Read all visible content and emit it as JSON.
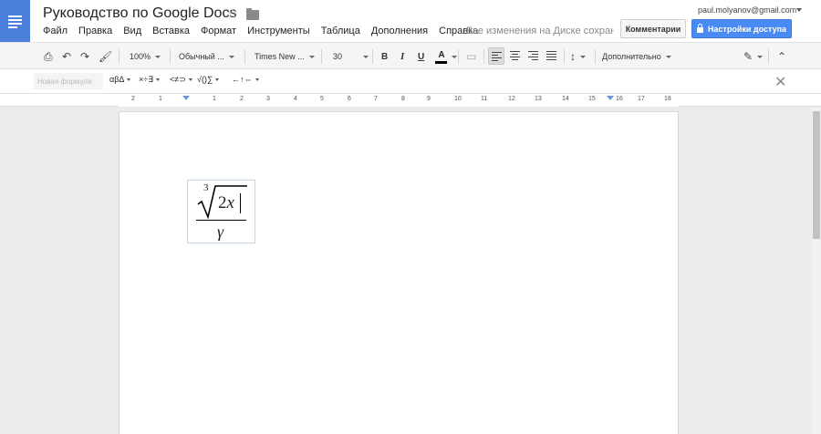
{
  "app": {
    "title": "Руководство по Google Docs",
    "menu": [
      "Файл",
      "Правка",
      "Вид",
      "Вставка",
      "Формат",
      "Инструменты",
      "Таблица",
      "Дополнения",
      "Справка"
    ],
    "save_status": "Все изменения на Диске сохран...",
    "user_email": "paul.molyanov@gmail.com",
    "comments_label": "Комментарии",
    "share_label": "Настройки доступа"
  },
  "toolbar": {
    "zoom": "100%",
    "style": "Обычный ...",
    "font": "Times New ...",
    "font_size": "30",
    "bold": "B",
    "italic": "I",
    "underline": "U",
    "text_color": "A",
    "more": "Дополнительно"
  },
  "equation_toolbar": {
    "input_placeholder": "Новая формула",
    "menus": [
      "αβΔ",
      "×÷∃",
      "<≠⊃",
      "√()∑",
      "←↑⇔"
    ]
  },
  "ruler": {
    "labels": [
      "2",
      "1",
      "1",
      "2",
      "3",
      "4",
      "5",
      "6",
      "7",
      "8",
      "9",
      "10",
      "11",
      "12",
      "13",
      "14",
      "15",
      "16",
      "17",
      "18"
    ]
  },
  "equation": {
    "root_index": "3",
    "radicand_number": "2",
    "radicand_variable": "x",
    "denominator": "γ"
  },
  "colors": {
    "accent_blue": "#4a8af4",
    "logo_blue": "#4a7fdc"
  }
}
